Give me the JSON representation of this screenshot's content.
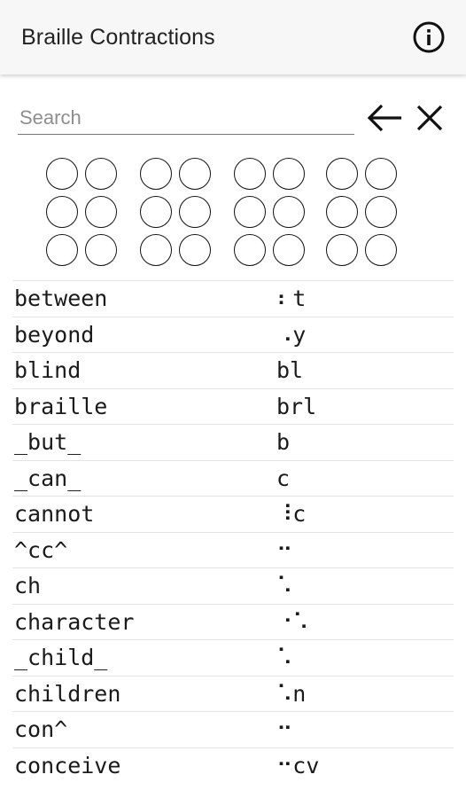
{
  "app": {
    "title": "Braille Contractions",
    "info_icon": "info-circle-icon"
  },
  "search": {
    "placeholder": "Search",
    "value": "",
    "back_icon": "arrow-left-icon",
    "clear_icon": "close-icon"
  },
  "braille_input": {
    "cells": 4,
    "dots_per_cell": 6,
    "filled": []
  },
  "contractions": [
    {
      "word": "between",
      "braille": "⠆t"
    },
    {
      "word": "beyond",
      "braille": "⠠y"
    },
    {
      "word": "blind",
      "braille": "bl"
    },
    {
      "word": "braille",
      "braille": "brl"
    },
    {
      "word": "_but_",
      "braille": "b"
    },
    {
      "word": "_can_",
      "braille": "c"
    },
    {
      "word": "cannot",
      "braille": "⠸c"
    },
    {
      "word": "^cc^",
      "braille": "⠒"
    },
    {
      "word": "ch",
      "braille": "⠡"
    },
    {
      "word": "character",
      "braille": "⠐⠡"
    },
    {
      "word": "_child_",
      "braille": "⠡"
    },
    {
      "word": "children",
      "braille": "⠡n"
    },
    {
      "word": "con^",
      "braille": "⠒"
    },
    {
      "word": "conceive",
      "braille": "⠒cv"
    }
  ]
}
